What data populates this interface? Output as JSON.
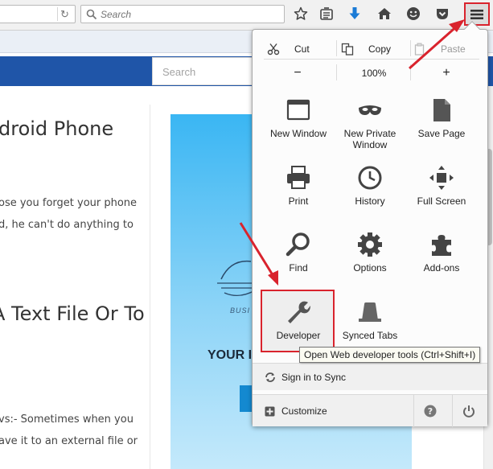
{
  "toolbar": {
    "search_placeholder": "Search",
    "icons": [
      "reload-icon",
      "search-icon",
      "star-icon",
      "reading-list-icon",
      "download-icon",
      "home-icon",
      "smiley-icon",
      "pocket-icon",
      "hamburger-menu-icon"
    ]
  },
  "page": {
    "site_search_placeholder": "Search",
    "title_1": "droid Phone",
    "para_1_line_1": "ose you forget your phone",
    "para_1_line_2": "d, he can't do anything to",
    "title_2": "A Text File Or To",
    "para_2_line_1": "vs:- Sometimes when you",
    "para_2_line_2": "ave it to an external file or",
    "ad_busi": "BUSI",
    "ad_your": "YOUR I"
  },
  "menu": {
    "edit": {
      "cut": "Cut",
      "copy": "Copy",
      "paste": "Paste"
    },
    "zoom": {
      "minus": "−",
      "level": "100%",
      "plus": "+"
    },
    "items": {
      "new_window": "New Window",
      "new_private_window": "New Private Window",
      "save_page": "Save Page",
      "print": "Print",
      "history": "History",
      "full_screen": "Full Screen",
      "find": "Find",
      "options": "Options",
      "addons": "Add-ons",
      "developer": "Developer",
      "synced_tabs": "Synced Tabs"
    },
    "tooltip": "Open Web developer tools (Ctrl+Shift+I)",
    "sign_in": "Sign in to Sync",
    "customize": "Customize"
  },
  "colors": {
    "highlight_red": "#d9232d",
    "toolbar_blue": "#1f55a8",
    "ad_blue": "#3ab6f3"
  }
}
